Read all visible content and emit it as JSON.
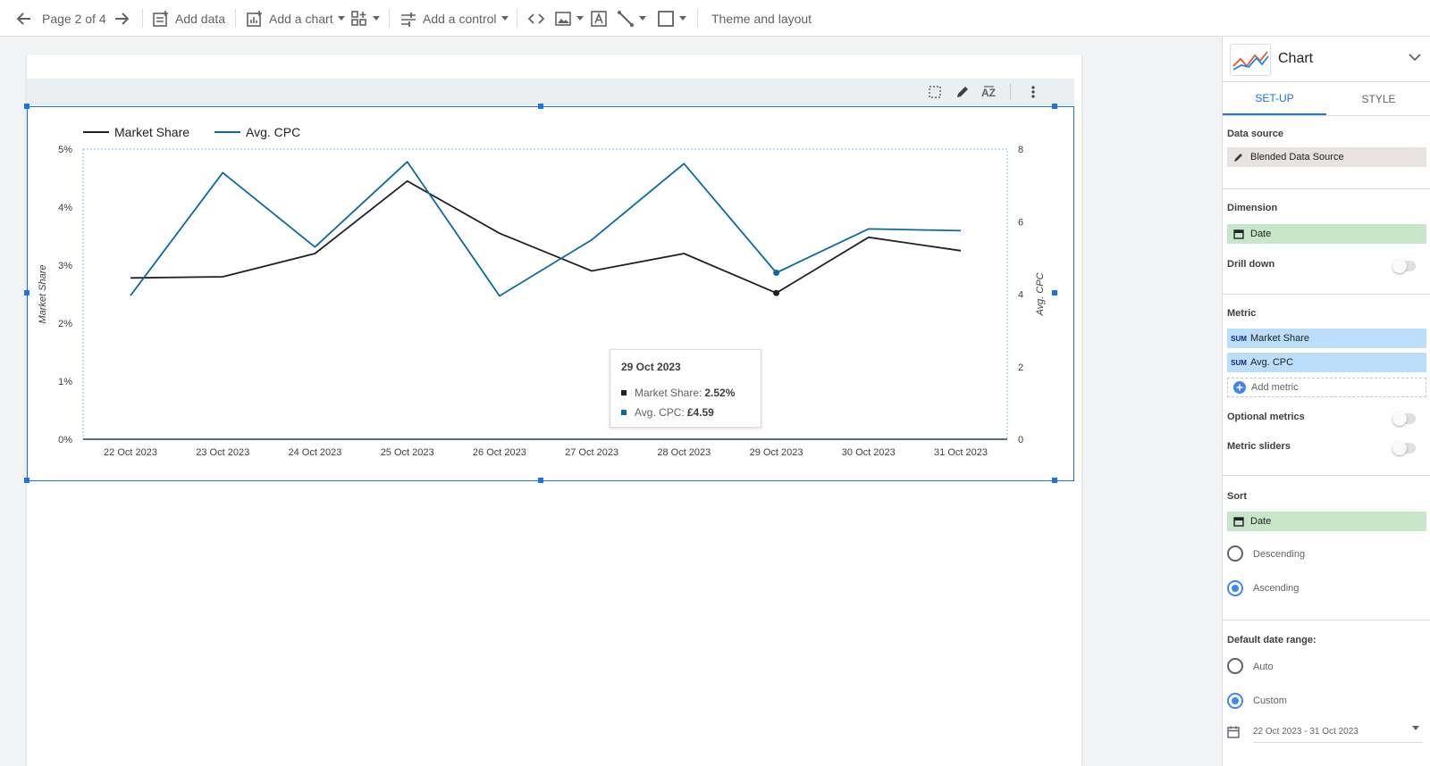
{
  "toolbar": {
    "page_indicator": "Page 2 of 4",
    "add_data": "Add data",
    "add_chart": "Add a chart",
    "add_control": "Add a control",
    "theme_layout": "Theme and layout"
  },
  "panel": {
    "title": "Chart",
    "tabs": {
      "setup": "SET-UP",
      "style": "STYLE"
    },
    "data_source": {
      "label": "Data source",
      "value": "Blended Data Source"
    },
    "dimension": {
      "label": "Dimension",
      "value": "Date"
    },
    "drill_down": {
      "label": "Drill down",
      "on": false
    },
    "metric": {
      "label": "Metric",
      "items": [
        {
          "agg": "SUM",
          "name": "Market Share"
        },
        {
          "agg": "SUM",
          "name": "Avg. CPC"
        }
      ],
      "add": "Add metric"
    },
    "optional_metrics": {
      "label": "Optional metrics",
      "on": false
    },
    "metric_sliders": {
      "label": "Metric sliders",
      "on": false
    },
    "sort": {
      "label": "Sort",
      "value": "Date",
      "descending": "Descending",
      "ascending": "Ascending",
      "selected": "Ascending"
    },
    "date_range": {
      "label": "Default date range:",
      "auto": "Auto",
      "custom": "Custom",
      "selected": "Custom",
      "value": "22 Oct 2023 - 31 Oct 2023"
    }
  },
  "tooltip": {
    "date": "29 Oct 2023",
    "rows": [
      {
        "label": "Market Share:",
        "value": "2.52%",
        "color": "#202124"
      },
      {
        "label": "Avg. CPC:",
        "value": "£4.59",
        "color": "#0b6aa2"
      }
    ]
  },
  "chart_data": {
    "type": "line",
    "x": [
      "22 Oct 2023",
      "23 Oct 2023",
      "24 Oct 2023",
      "25 Oct 2023",
      "26 Oct 2023",
      "27 Oct 2023",
      "28 Oct 2023",
      "29 Oct 2023",
      "30 Oct 2023",
      "31 Oct 2023"
    ],
    "series": [
      {
        "name": "Market Share",
        "axis": "left",
        "color": "#202124",
        "values": [
          2.78,
          2.8,
          3.2,
          4.45,
          3.55,
          2.9,
          3.2,
          2.52,
          3.48,
          3.25
        ]
      },
      {
        "name": "Avg. CPC",
        "axis": "right",
        "color": "#0b6aa2",
        "values": [
          3.96,
          7.35,
          5.3,
          7.65,
          3.95,
          5.5,
          7.6,
          4.59,
          5.8,
          5.75
        ]
      }
    ],
    "ylabel_left": "Market Share",
    "ylabel_right": "Avg. CPC",
    "yticks_left": [
      "0%",
      "1%",
      "2%",
      "3%",
      "4%",
      "5%"
    ],
    "ylim_left": [
      0,
      5
    ],
    "yticks_right": [
      "0",
      "2",
      "4",
      "6",
      "8"
    ],
    "ylim_right": [
      0,
      8
    ],
    "highlight_index": 7,
    "legend_position": "top-left"
  }
}
